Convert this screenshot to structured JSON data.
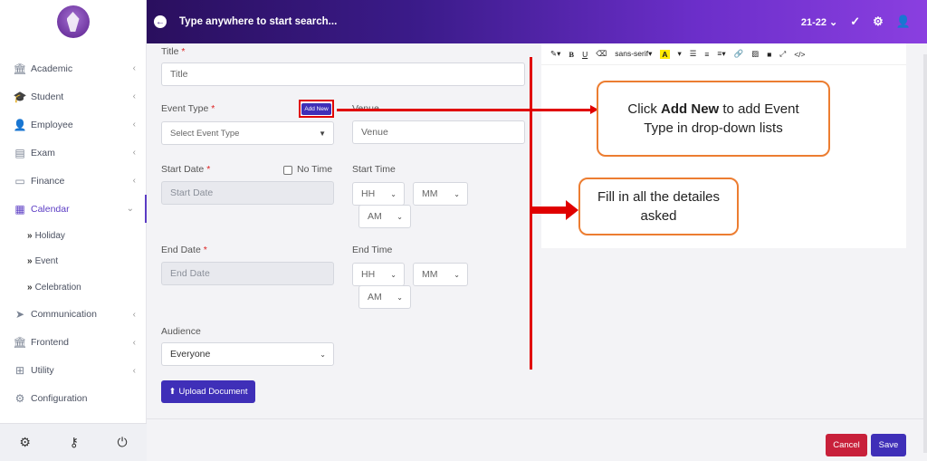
{
  "sidebar": {
    "items": [
      {
        "label": "Academic",
        "icon": "building-icon"
      },
      {
        "label": "Student",
        "icon": "graduation-cap-icon"
      },
      {
        "label": "Employee",
        "icon": "user-tie-icon"
      },
      {
        "label": "Exam",
        "icon": "file-icon"
      },
      {
        "label": "Finance",
        "icon": "money-icon"
      },
      {
        "label": "Calendar",
        "icon": "calendar-icon",
        "active": true
      }
    ],
    "sub_items": [
      "Holiday",
      "Event",
      "Celebration"
    ],
    "items_after": [
      {
        "label": "Communication",
        "icon": "paper-plane-icon"
      },
      {
        "label": "Frontend",
        "icon": "building-icon"
      },
      {
        "label": "Utility",
        "icon": "sitemap-icon"
      },
      {
        "label": "Configuration",
        "icon": "cogs-icon"
      }
    ],
    "sub_marker": "»"
  },
  "topbar": {
    "search_placeholder": "Type anywhere to start search...",
    "session": "21-22"
  },
  "form": {
    "title_label": "Title",
    "title_placeholder": "Title",
    "event_type_label": "Event Type",
    "add_new_label": "Add New",
    "event_type_placeholder": "Select Event Type",
    "venue_label": "Venue",
    "venue_placeholder": "Venue",
    "start_date_label": "Start Date",
    "no_time_label": "No Time",
    "start_date_placeholder": "Start Date",
    "start_time_label": "Start Time",
    "end_date_label": "End Date",
    "end_date_placeholder": "End Date",
    "end_time_label": "End Time",
    "hh": "HH",
    "mm": "MM",
    "am": "AM",
    "audience_label": "Audience",
    "audience_value": "Everyone",
    "upload_label": "Upload Document",
    "required_mark": "*"
  },
  "editor": {
    "font_name": "sans-serif",
    "bold": "B",
    "underline": "U"
  },
  "actions": {
    "cancel": "Cancel",
    "save": "Save"
  },
  "annotations": {
    "callout1_pre": "Click ",
    "callout1_bold": "Add New",
    "callout1_post": " to add Event Type in drop-down lists",
    "callout2": "Fill in all the detailes asked"
  },
  "colors": {
    "accent": "#3f2fb8",
    "annotation_red": "#e00000",
    "callout_border": "#ec7d31",
    "cancel": "#c8203a"
  }
}
